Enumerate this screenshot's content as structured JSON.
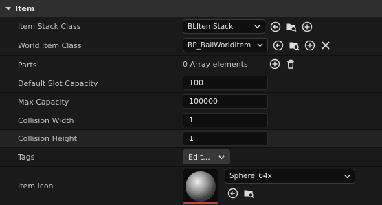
{
  "section": {
    "title": "Item"
  },
  "rows": {
    "item_stack_class": {
      "label": "Item Stack Class",
      "value": "BLItemStack"
    },
    "world_item_class": {
      "label": "World Item Class",
      "value": "BP_BallWorldItem"
    },
    "parts": {
      "label": "Parts",
      "value": "0 Array elements"
    },
    "default_slot_capacity": {
      "label": "Default Slot Capacity",
      "value": "100"
    },
    "max_capacity": {
      "label": "Max Capacity",
      "value": "100000"
    },
    "collision_width": {
      "label": "Collision Width",
      "value": "1"
    },
    "collision_height": {
      "label": "Collision Height",
      "value": "1"
    },
    "tags": {
      "label": "Tags",
      "button": "Edit..."
    },
    "item_icon": {
      "label": "Item Icon",
      "value": "Sphere_64x"
    }
  },
  "icons": {
    "collapse": "chevron-down-icon",
    "use_selected": "arrow-left-circle-icon",
    "browse": "folder-search-icon",
    "add": "plus-circle-icon",
    "clear": "close-icon",
    "delete": "trash-icon"
  },
  "colors": {
    "accent_bar": "#b94a3c",
    "header_bg": "#2f2f2f"
  }
}
